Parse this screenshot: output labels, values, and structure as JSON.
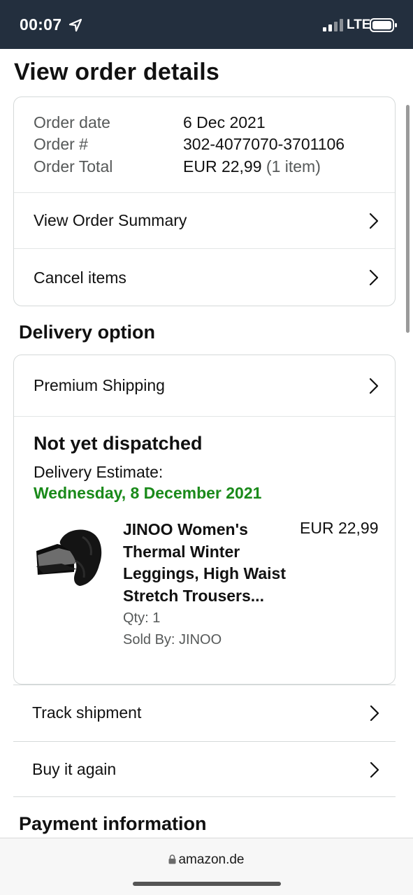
{
  "status_bar": {
    "time": "00:07",
    "network": "LTE",
    "icons": [
      "location-arrow-icon",
      "signal-bars-icon",
      "battery-icon"
    ]
  },
  "page": {
    "title": "View order details"
  },
  "order_info": {
    "date_label": "Order date",
    "date_value": "6 Dec 2021",
    "number_label": "Order #",
    "number_value": "302-4077070-3701106",
    "total_label": "Order Total",
    "total_value": "EUR 22,99",
    "total_items": "(1 item)"
  },
  "order_actions": {
    "summary_label": "View Order Summary",
    "cancel_label": "Cancel items"
  },
  "delivery": {
    "heading": "Delivery option",
    "shipping_label": "Premium Shipping",
    "status_title": "Not yet dispatched",
    "estimate_label": "Delivery Estimate:",
    "estimate_date": "Wednesday, 8 December 2021"
  },
  "product": {
    "title": "JINOO Women's Thermal Winter Leggings, High Waist Stretch Trousers...",
    "price": "EUR 22,99",
    "qty": "Qty: 1",
    "seller": "Sold By: JINOO"
  },
  "shipment_actions": {
    "track_label": "Track shipment",
    "buy_again_label": "Buy it again"
  },
  "payment": {
    "heading": "Payment information"
  },
  "browser": {
    "url": "amazon.de"
  },
  "colors": {
    "status_bar_bg": "#232f3e",
    "delivery_date_green": "#1a8a1a",
    "muted_text": "#565959"
  }
}
